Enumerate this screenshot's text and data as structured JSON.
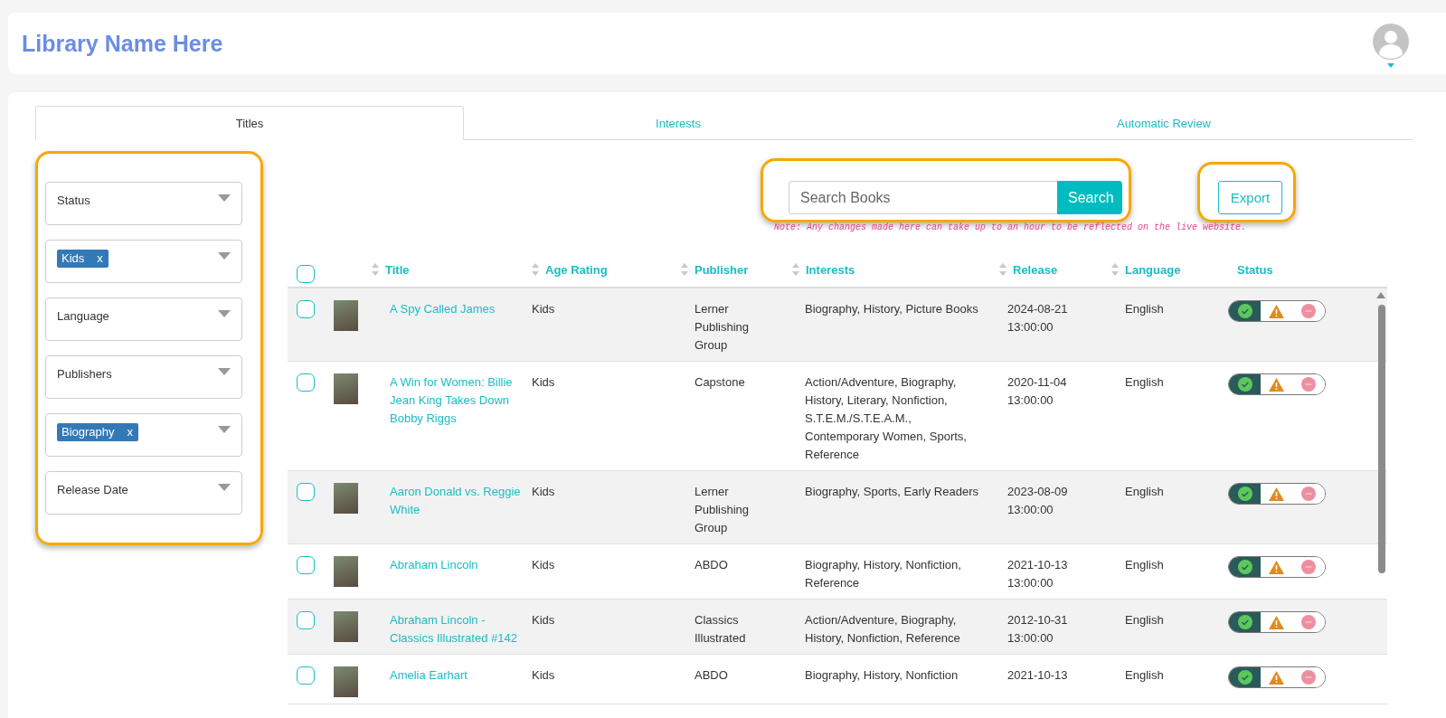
{
  "header": {
    "title": "Library Name Here"
  },
  "tabs": [
    {
      "label": "Titles",
      "selected": true
    },
    {
      "label": "Interests",
      "selected": false
    },
    {
      "label": "Automatic Review",
      "selected": false
    }
  ],
  "filters": [
    {
      "kind": "select",
      "placeholder": "Status"
    },
    {
      "kind": "chips",
      "chips": [
        {
          "label": "Kids",
          "remove": "x"
        }
      ]
    },
    {
      "kind": "select",
      "placeholder": "Language"
    },
    {
      "kind": "select",
      "placeholder": "Publishers"
    },
    {
      "kind": "chips",
      "chips": [
        {
          "label": "Biography",
          "remove": "x"
        }
      ]
    },
    {
      "kind": "select",
      "placeholder": "Release Date"
    }
  ],
  "search": {
    "placeholder": "Search Books",
    "button": "Search"
  },
  "export": "Export",
  "note": "Note: Any changes made here can take up to an hour to be reflected on the live website.",
  "table": {
    "select_all_checked": false,
    "columns": [
      {
        "label": "Title",
        "sortable": true
      },
      {
        "label": "Age Rating",
        "sortable": true
      },
      {
        "label": "Publisher",
        "sortable": true
      },
      {
        "label": "Interests",
        "sortable": true
      },
      {
        "label": "Release",
        "sortable": true
      },
      {
        "label": "Language",
        "sortable": true
      },
      {
        "label": "Status",
        "sortable": false
      }
    ],
    "rows": [
      {
        "checked": false,
        "title": "A Spy Called James",
        "age_rating": "Kids",
        "publisher": "Lerner Publishing Group",
        "interests": "Biography, History, Picture Books",
        "release": "2024-08-21 13:00:00",
        "language": "English",
        "status": [
          {
            "kind": "approve",
            "selected": true
          },
          {
            "kind": "warning",
            "selected": false
          },
          {
            "kind": "reject",
            "selected": false
          }
        ]
      },
      {
        "checked": false,
        "title": "A Win for Women: Billie Jean King Takes Down Bobby Riggs",
        "age_rating": "Kids",
        "publisher": "Capstone",
        "interests": "Action/Adventure, Biography, History, Literary, Nonfiction, S.T.E.M./S.T.E.A.M., Contemporary Women, Sports, Reference",
        "release": "2020-11-04 13:00:00",
        "language": "English",
        "status": [
          {
            "kind": "approve",
            "selected": true
          },
          {
            "kind": "warning",
            "selected": false
          },
          {
            "kind": "reject",
            "selected": false
          }
        ]
      },
      {
        "checked": false,
        "title": "Aaron Donald vs. Reggie White",
        "age_rating": "Kids",
        "publisher": "Lerner Publishing Group",
        "interests": "Biography, Sports, Early Readers",
        "release": "2023-08-09 13:00:00",
        "language": "English",
        "status": [
          {
            "kind": "approve",
            "selected": true
          },
          {
            "kind": "warning",
            "selected": false
          },
          {
            "kind": "reject",
            "selected": false
          }
        ]
      },
      {
        "checked": false,
        "title": "Abraham Lincoln",
        "age_rating": "Kids",
        "publisher": "ABDO",
        "interests": "Biography, History, Nonfiction, Reference",
        "release": "2021-10-13 13:00:00",
        "language": "English",
        "status": [
          {
            "kind": "approve",
            "selected": true
          },
          {
            "kind": "warning",
            "selected": false
          },
          {
            "kind": "reject",
            "selected": false
          }
        ]
      },
      {
        "checked": false,
        "title": "Abraham Lincoln - Classics Illustrated #142",
        "age_rating": "Kids",
        "publisher": "Classics Illustrated",
        "interests": "Action/Adventure, Biography, History, Nonfiction, Reference",
        "release": "2012-10-31 13:00:00",
        "language": "English",
        "status": [
          {
            "kind": "approve",
            "selected": true
          },
          {
            "kind": "warning",
            "selected": false
          },
          {
            "kind": "reject",
            "selected": false
          }
        ]
      },
      {
        "checked": false,
        "title": "Amelia Earhart",
        "age_rating": "Kids",
        "publisher": "ABDO",
        "interests": "Biography, History, Nonfiction",
        "release": "2021-10-13",
        "language": "English",
        "status": [
          {
            "kind": "approve",
            "selected": true
          },
          {
            "kind": "warning",
            "selected": false
          },
          {
            "kind": "reject",
            "selected": false
          }
        ]
      }
    ]
  }
}
